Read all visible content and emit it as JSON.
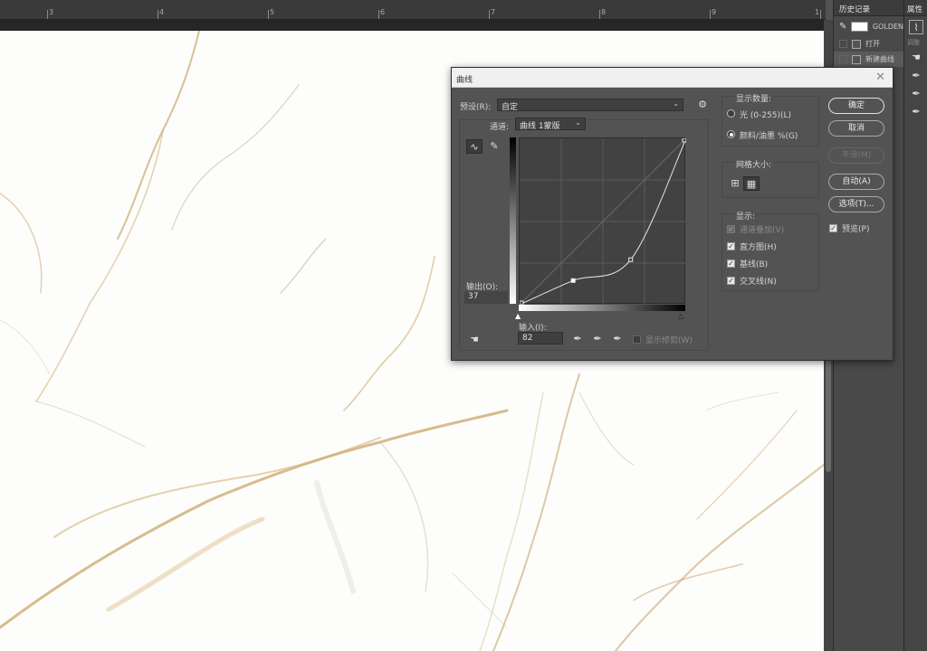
{
  "ruler": {
    "numbers": [
      "3",
      "4",
      "5",
      "6",
      "7",
      "8",
      "9",
      "1"
    ]
  },
  "history": {
    "tab_label": "历史记录",
    "snapshot_label": "GOLDEN",
    "items": [
      "打开",
      "新建曲线"
    ]
  },
  "properties": {
    "tab_label": "属性",
    "faded_label": "调整"
  },
  "curves": {
    "title": "曲线",
    "preset_label": "预设(R):",
    "preset_value": "自定",
    "channel_label": "通道:",
    "channel_value": "曲线 1蒙版",
    "output_label": "输出(O):",
    "output_value": "37",
    "input_label": "输入(I):",
    "input_value": "82",
    "show_clipping_label": "显示修剪(W)",
    "display_amount": {
      "legend": "显示数量:",
      "light_label": "光 (0-255)(L)",
      "pigment_label": "颜料/油墨 %(G)",
      "selected": "pigment"
    },
    "grid_size": {
      "legend": "网格大小:"
    },
    "show": {
      "legend": "显示:",
      "channel_overlay": {
        "label": "通道叠加(V)",
        "checked": true,
        "enabled": false
      },
      "histogram": {
        "label": "直方图(H)",
        "checked": true
      },
      "baseline": {
        "label": "基线(B)",
        "checked": true
      },
      "intersection": {
        "label": "交叉线(N)",
        "checked": true
      }
    },
    "buttons": {
      "ok": "确定",
      "cancel": "取消",
      "smooth": "平滑(M)",
      "auto": "自动(A)",
      "options": "选项(T)..."
    },
    "preview": {
      "label": "预览(P)",
      "checked": true
    },
    "curve_points": [
      [
        0,
        0
      ],
      [
        82,
        37
      ],
      [
        170,
        69
      ],
      [
        255,
        255
      ]
    ]
  }
}
